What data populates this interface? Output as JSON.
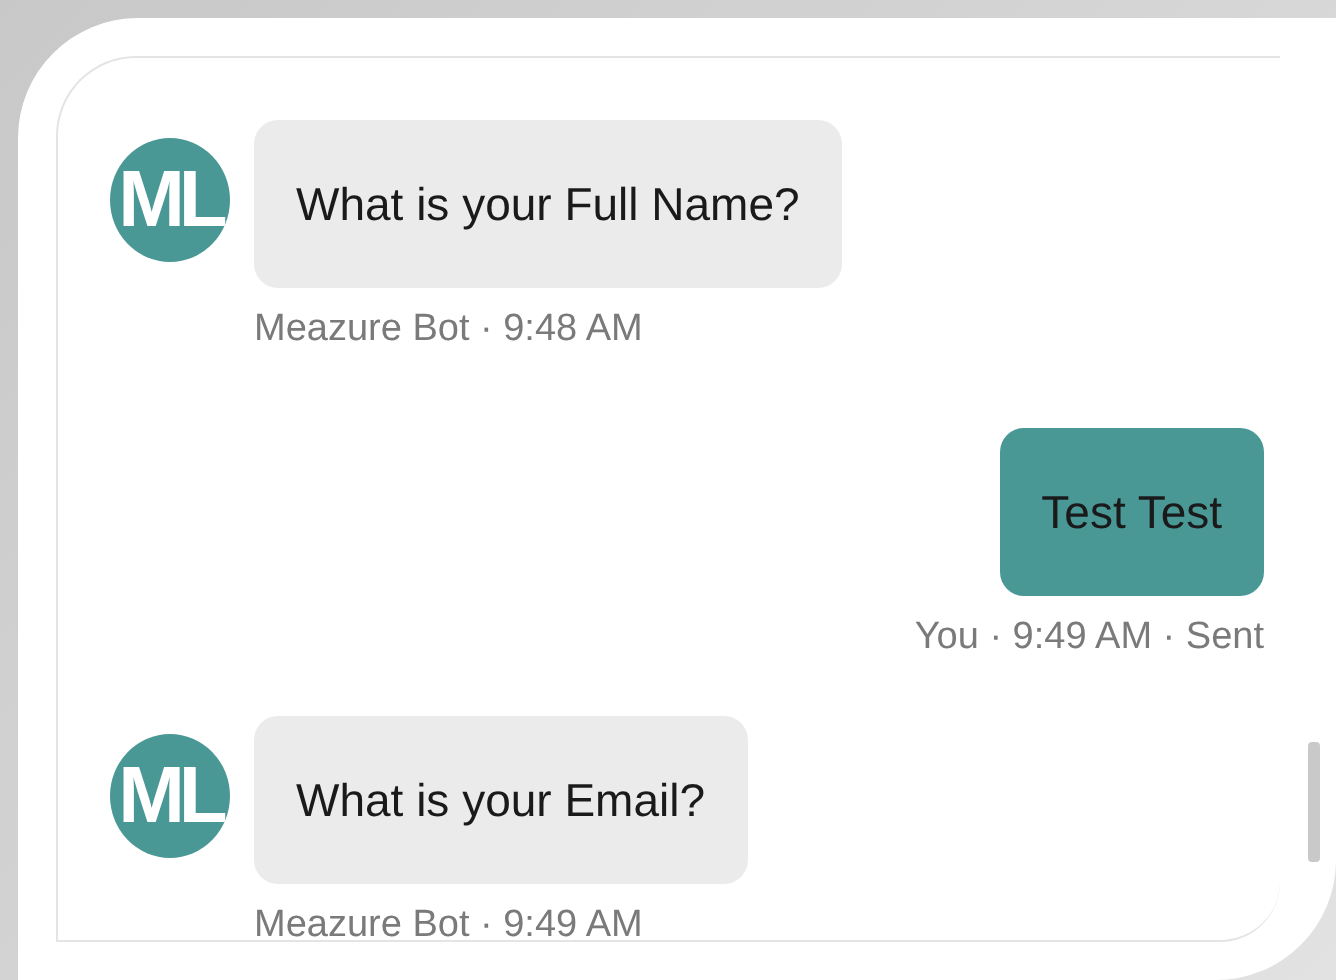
{
  "messages": [
    {
      "kind": "bot",
      "avatar": "ML",
      "text": "What is your Full Name?",
      "meta": "Meazure Bot · 9:48 AM"
    },
    {
      "kind": "user",
      "text": "Test Test",
      "meta": "You · 9:49 AM · Sent"
    },
    {
      "kind": "bot",
      "avatar": "ML",
      "text": "What is your Email?",
      "meta": "Meazure Bot · 9:49 AM"
    }
  ]
}
